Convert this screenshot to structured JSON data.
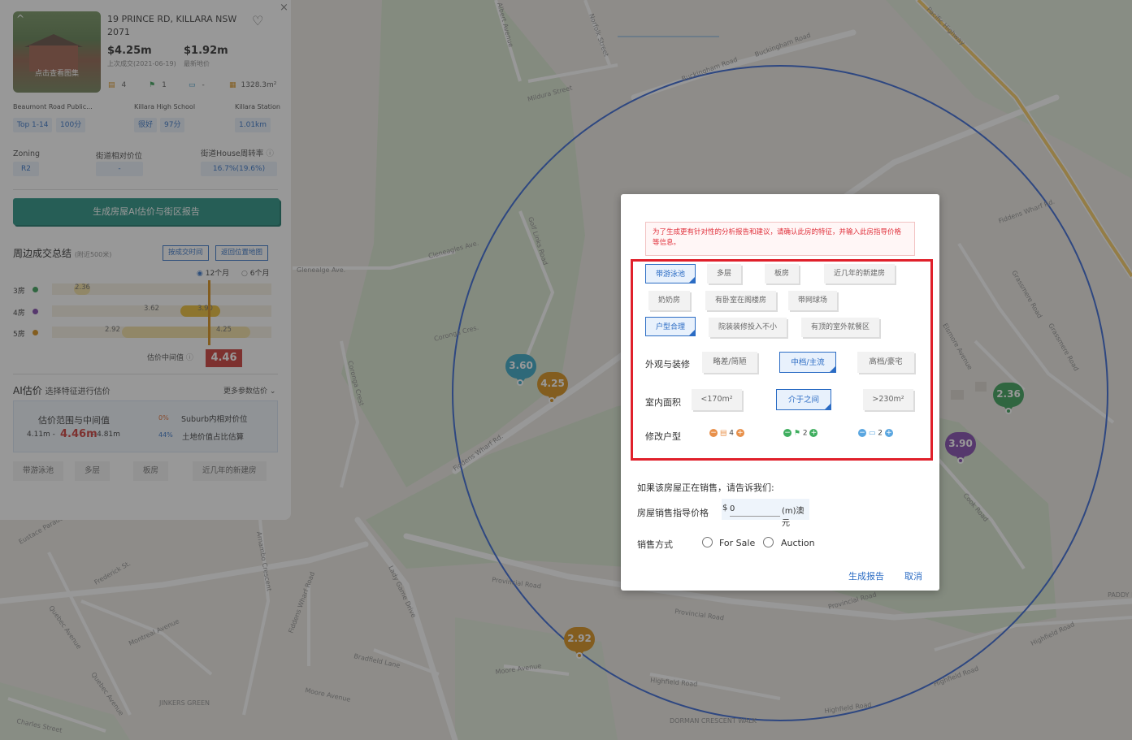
{
  "map": {
    "streets": [
      "Pacific Highway",
      "Buckingham Road",
      "Buckingham Road",
      "Norfolk Street",
      "Albert Avenue",
      "Mildura Street",
      "Golf Links Road",
      "Cleneagles Ave.",
      "Glenealge Ave.",
      "Coronga Cres.",
      "Coronga Crest",
      "Fiddens Wharf Rd.",
      "Fiddens Wharf Rd.",
      "Grassmere Road",
      "Grassmere Road",
      "Elsmore Avenue",
      "Cook Road",
      "Eustace Parade",
      "Frederick St.",
      "Quebec Avenue",
      "Montreal Avenue",
      "Quebec Avenue",
      "Fiddens Wharf Road",
      "Lady Game Drive",
      "Provincial Road",
      "Provincial Road",
      "Provincial Road",
      "Bradfield Lane",
      "Moore Avenue",
      "Moore Avenue",
      "Highfield Road",
      "Highfield Road",
      "Highfield Road",
      "Highfield Road",
      "Charles Street",
      "Arnambo Crescent",
      "JINKERS GREEN",
      "DORMAN CRESCENT WALK",
      "PADDY RESE"
    ],
    "markers": [
      {
        "label": "3.60",
        "color": "#2aa1c0"
      },
      {
        "label": "4.25",
        "color": "#d4890c"
      },
      {
        "label": "2.36",
        "color": "#2e9a4e"
      },
      {
        "label": "3.90",
        "color": "#7b3fa8"
      },
      {
        "label": "2.92",
        "color": "#d4890c"
      }
    ]
  },
  "panel": {
    "photo_caption": "点击查看图集",
    "address": "19 PRINCE RD, KILLARA NSW 2071",
    "last_sold_price": "$4.25m",
    "last_sold_label": "上次成交(2021-06-19)",
    "latest_price": "$1.92m",
    "latest_label": "最新地价",
    "bedrooms": "4",
    "bathrooms": "1",
    "parking": "-",
    "land_area": "1328.3m²",
    "schools": [
      {
        "name": "Beaumont Road Public...",
        "rank": "Top 1-14",
        "score": "100分"
      },
      {
        "name": "Killara High School",
        "rank": "很好",
        "score": "97分"
      },
      {
        "name": "Killara Station",
        "rank": "1.01km"
      }
    ],
    "zoning_label": "Zoning",
    "zoning_value": "R2",
    "relative_price_label": "街道相对价位",
    "relative_price_value": "-",
    "turnover_label": "街道House周转率",
    "turnover_value": "16.7%(19.6%)",
    "report_button": "生成房屋AI估价与街区报告",
    "summary_title": "周边成交总结",
    "summary_sub": "(附近500米)",
    "by_time_button": "按成交时间",
    "back_button": "返回位置地图",
    "period_12": "12个月",
    "period_6": "6个月",
    "rows": [
      {
        "label": "3房",
        "color": "#2e9a4e",
        "min": "2.36",
        "min_value": 2.36,
        "max_value": 2.36
      },
      {
        "label": "4房",
        "color": "#7b3fa8",
        "min": "3.62",
        "max": "3.90",
        "min_value": 3.62,
        "max_value": 3.9
      },
      {
        "label": "5房",
        "color": "#d4890c",
        "min": "2.92",
        "max": "4.25",
        "min_value": 2.92,
        "max_value": 4.25
      }
    ],
    "median_label": "估价中间值",
    "median_value": "4.46",
    "ai_title": "AI估价",
    "ai_sub": "选择特征进行估价",
    "more_params": "更多参数估价",
    "range_title": "估价范围与中间值",
    "range_low": "4.11m -",
    "range_mid": "4.46m",
    "range_high": "- 4.81m",
    "suburb_pct": "0%",
    "suburb_label": "Suburb内相对价位",
    "land_pct": "44%",
    "land_label": "土地价值占比估算",
    "chips": [
      "带游泳池",
      "多层",
      "板房",
      "近几年的新建房"
    ]
  },
  "dialog": {
    "notice": "为了生成更有针对性的分析报告和建议，请确认此房的特征，并输入此房指导价格等信息。",
    "tags": [
      {
        "label": "带游泳池",
        "selected": true
      },
      {
        "label": "多层",
        "selected": false
      },
      {
        "label": "板房",
        "selected": false
      },
      {
        "label": "近几年的新建房",
        "selected": false
      },
      {
        "label": "奶奶房",
        "selected": false
      },
      {
        "label": "有卧室在阁楼房",
        "selected": false
      },
      {
        "label": "带网球场",
        "selected": false
      },
      {
        "label": "户型合理",
        "selected": true
      },
      {
        "label": "院装装修投入不小",
        "selected": false
      },
      {
        "label": "有顶的室外就餐区",
        "selected": false
      }
    ],
    "exterior_label": "外观与装修",
    "exterior_options": [
      {
        "label": "略差/简陋",
        "selected": false
      },
      {
        "label": "中档/主流",
        "selected": true
      },
      {
        "label": "高档/豪宅",
        "selected": false
      }
    ],
    "area_label": "室内面积",
    "area_options": [
      {
        "label": "<170m²",
        "selected": false
      },
      {
        "label": "介于之间",
        "selected": true
      },
      {
        "label": ">230m²",
        "selected": false
      }
    ],
    "layout_label": "修改户型",
    "bed_count": "4",
    "bath_count": "2",
    "car_count": "2",
    "sale_prompt": "如果该房屋正在销售，请告诉我们:",
    "price_label": "房屋销售指导价格",
    "currency": "$",
    "price_value": "0",
    "price_unit": "(m)澳元",
    "sale_method_label": "销售方式",
    "for_sale": "For Sale",
    "auction": "Auction",
    "generate": "生成报告",
    "cancel": "取消"
  }
}
